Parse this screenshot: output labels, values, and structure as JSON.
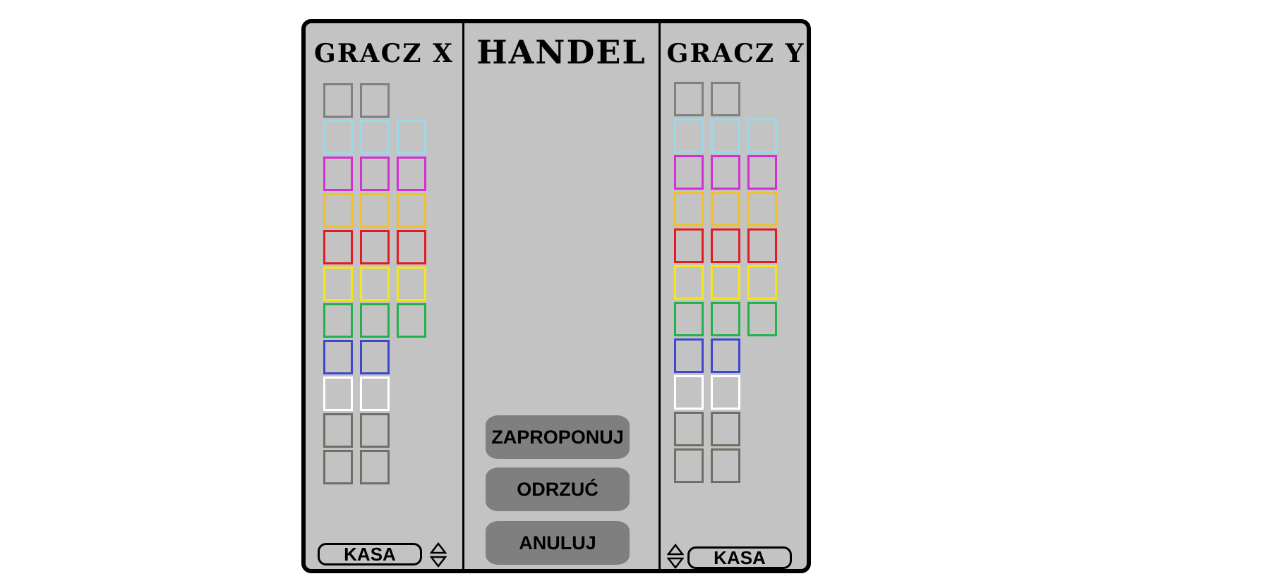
{
  "player_x": {
    "title": "GRACZ X",
    "kasa_label": "KASA"
  },
  "trade": {
    "title": "HANDEL",
    "buttons": {
      "propose": "ZAPROPONUJ",
      "reject": "ODRZUĆ",
      "cancel": "ANULUJ"
    }
  },
  "player_y": {
    "title": "GRACZ Y",
    "kasa_label": "KASA"
  },
  "colors": {
    "board_bg": "#c3c3c3",
    "button_bg": "#7f7f7f",
    "property_groups": [
      {
        "name": "grey",
        "color": "#808080",
        "count": 2
      },
      {
        "name": "light-blue",
        "color": "#99d9ea",
        "count": 3
      },
      {
        "name": "pink",
        "color": "#d42fd4",
        "count": 3
      },
      {
        "name": "orange-yellow",
        "color": "#f2c02a",
        "count": 3
      },
      {
        "name": "red",
        "color": "#e01b24",
        "count": 3
      },
      {
        "name": "yellow",
        "color": "#f5e616",
        "count": 3
      },
      {
        "name": "green",
        "color": "#22b14c",
        "count": 3
      },
      {
        "name": "blue",
        "color": "#3f48cc",
        "count": 2
      },
      {
        "name": "white",
        "color": "#ffffff",
        "count": 2
      },
      {
        "name": "dark-grey",
        "color": "#6f6f66",
        "count": 2
      },
      {
        "name": "dark-grey-2",
        "color": "#6f6f66",
        "count": 2
      }
    ]
  },
  "icons": {
    "stepper": "up-down-triangle-icon"
  }
}
